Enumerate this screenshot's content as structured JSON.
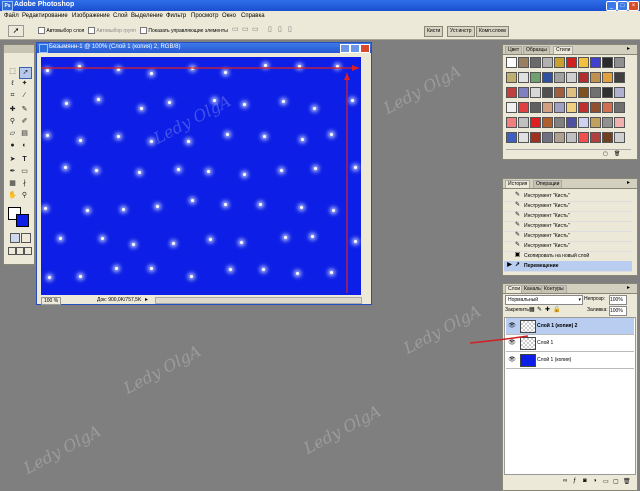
{
  "app": {
    "title": "Adobe Photoshop",
    "icon": "ps-icon",
    "controls": [
      "_",
      "□",
      "×"
    ]
  },
  "menu": [
    "Файл",
    "Редактирование",
    "Изображение",
    "Слой",
    "Выделение",
    "Фильтр",
    "Просмотр",
    "Окно",
    "Справка"
  ],
  "options": {
    "auto_select_layer": "Автовыбор слоя",
    "auto_select_groups": "Автовыбор групп",
    "show_transform_controls": "Показать управляющие элементы",
    "tabs": [
      "Кисти",
      "Уст.инстр",
      "Комп.слоев"
    ]
  },
  "document": {
    "title": "Безымянн-1 @ 100% (Слой 1 (копия) 2, RGB/8)",
    "zoom": "100 %",
    "doc_info": "Док: 900,0K/757,5K",
    "canvas_color": "#0d1fe6"
  },
  "styles_panel": {
    "tabs": [
      "Цвет",
      "Образцы",
      "Стили"
    ],
    "active_tab": "Стили",
    "swatch_colors": [
      "#ffffff",
      "#9a8060",
      "#6a6a6a",
      "#b0b0b0",
      "#c8a030",
      "#d02020",
      "#f0c040",
      "#4040d0",
      "#2a2a2a",
      "#909090",
      "#c0b070",
      "#e0e0e0",
      "#70a070",
      "#3050a0",
      "#a0a0a0",
      "#d0d0d0",
      "#b03030",
      "#c09050",
      "#e0a040",
      "#404040",
      "#c04040",
      "#8080c0",
      "#d8d8d8",
      "#505050",
      "#a06040",
      "#e0c080",
      "#805020",
      "#707070",
      "#303030",
      "#b0b0d0",
      "#f0f0f0",
      "#e04040",
      "#606060",
      "#d0a080",
      "#a0a0c0",
      "#f0d080",
      "#c03030",
      "#905030",
      "#d07050",
      "#707070",
      "#f08080",
      "#c0c0c0",
      "#e02020",
      "#b06030",
      "#808080",
      "#5050a0",
      "#d0d0f0",
      "#c0a060",
      "#909090",
      "#f0b0b0",
      "#4060c0",
      "#e0e0e0",
      "#a03020",
      "#707080",
      "#b0a090",
      "#c0c0c0",
      "#f05050",
      "#b04040",
      "#704020",
      "#d0d0d0"
    ]
  },
  "history_panel": {
    "tabs": [
      "История",
      "Операции"
    ],
    "rows": [
      "Инструмент \"Кисть\"",
      "Инструмент \"Кисть\"",
      "Инструмент \"Кисть\"",
      "Инструмент \"Кисть\"",
      "Инструмент \"Кисть\"",
      "Инструмент \"Кисть\"",
      "Скопировать на новый слой",
      "Перемещение"
    ]
  },
  "layers_panel": {
    "tabs": [
      "Слои",
      "Каналы",
      "Контуры"
    ],
    "blend_mode": "Нормальный",
    "opacity_label": "Непрозр:",
    "opacity": "100%",
    "lock_label": "Закрепить:",
    "fill_label": "Заливка:",
    "fill": "100%",
    "layers": [
      {
        "name": "Слой 1 (копия) 2",
        "selected": true,
        "thumb": "checker"
      },
      {
        "name": "Слой 1",
        "selected": false,
        "thumb": "checker"
      },
      {
        "name": "Слой 1 (копия)",
        "selected": false,
        "thumb": "blue"
      }
    ]
  },
  "watermark": "Ledy OlgA"
}
